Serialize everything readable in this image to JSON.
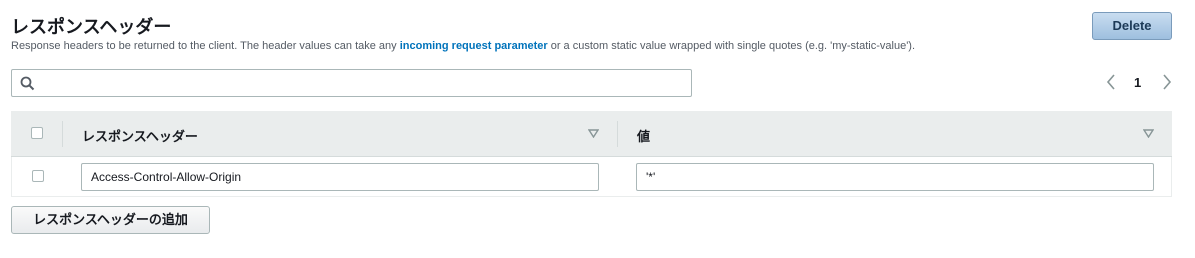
{
  "header": {
    "title": "レスポンスヘッダー",
    "subtitle_before": "Response headers to be returned to the client. The header values can take any ",
    "subtitle_link": "incoming request parameter",
    "subtitle_after": " or a custom static value wrapped with single quotes (e.g. 'my-static-value').",
    "delete_label": "Delete"
  },
  "search": {
    "placeholder": "",
    "value": "",
    "icon": "search-icon"
  },
  "pagination": {
    "current_page": "1",
    "prev_icon": "chevron-left-icon",
    "next_icon": "chevron-right-icon"
  },
  "table": {
    "columns": [
      "レスポンスヘッダー",
      "値"
    ],
    "rows": [
      {
        "header": "Access-Control-Allow-Origin",
        "value": "'*'"
      }
    ]
  },
  "add_button_label": "レスポンスヘッダーの追加",
  "colors": {
    "accent": "#0073bb",
    "header_bg": "#eaeded",
    "primary_button": "#a8c6e4"
  }
}
